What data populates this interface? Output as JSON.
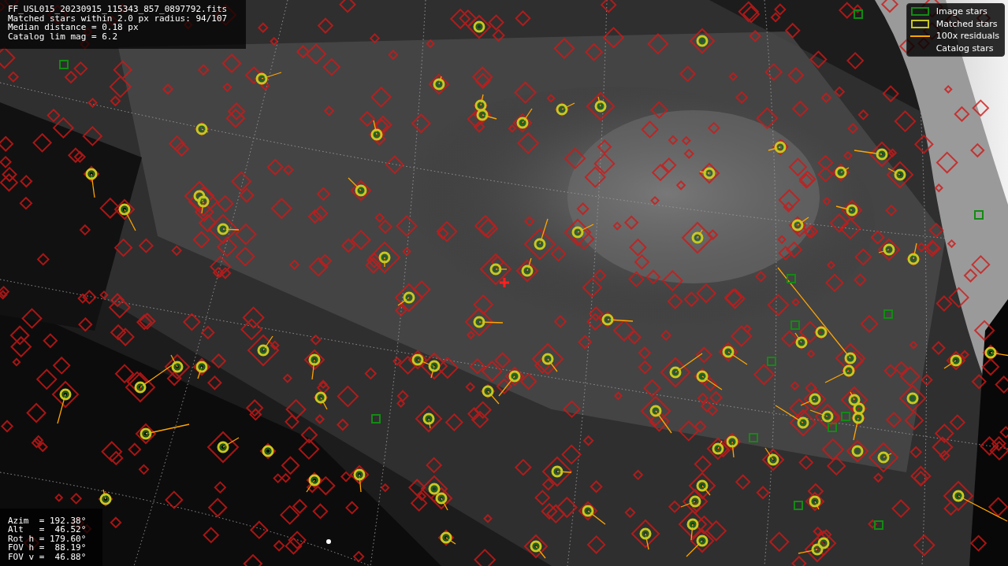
{
  "file_info": {
    "lines": [
      "FF_USL015_20230915_115343_857_0897792.fits",
      "Matched stars within 2.0 px radius: 94/107",
      "Median distance = 0.18 px",
      "Catalog lim mag = 6.2"
    ]
  },
  "legend": {
    "items": [
      {
        "label": "Image stars",
        "kind": "square",
        "color": "#138a13"
      },
      {
        "label": "Matched stars",
        "kind": "square",
        "color": "#c8c820"
      },
      {
        "label": "100x residuals",
        "kind": "line",
        "color": "#ffa500"
      },
      {
        "label": "Catalog stars",
        "kind": "none"
      }
    ]
  },
  "pointing": {
    "lines": [
      "Azim  = 192.38°",
      "Alt   =  46.52°",
      "Rot h = 179.60°",
      "FOV h =  88.19°",
      "FOV v =  46.88°"
    ]
  }
}
